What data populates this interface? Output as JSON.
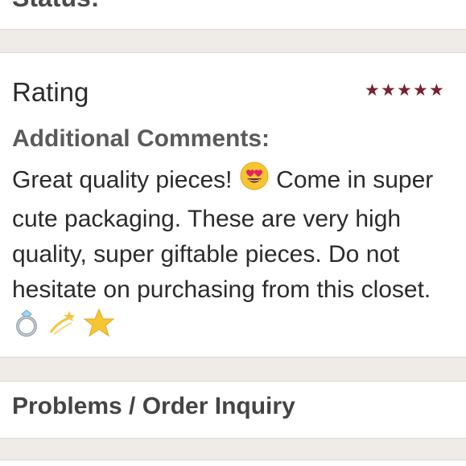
{
  "status_section": {
    "label": "Status:"
  },
  "rating_section": {
    "title": "Rating",
    "stars": 5,
    "star_color": "#7b1f2e",
    "comments_label": "Additional Comments:",
    "comments_part1": "Great quality pieces!",
    "comments_part2": "Come in super cute packaging. These are very high quality, super giftable pieces. Do not hesitate on purchasing from this closet.",
    "emoji_icons": [
      "heart-eyes-icon",
      "ring-icon",
      "dizzy-icon",
      "star-icon"
    ]
  },
  "problems_section": {
    "title": "Problems / Order Inquiry"
  }
}
